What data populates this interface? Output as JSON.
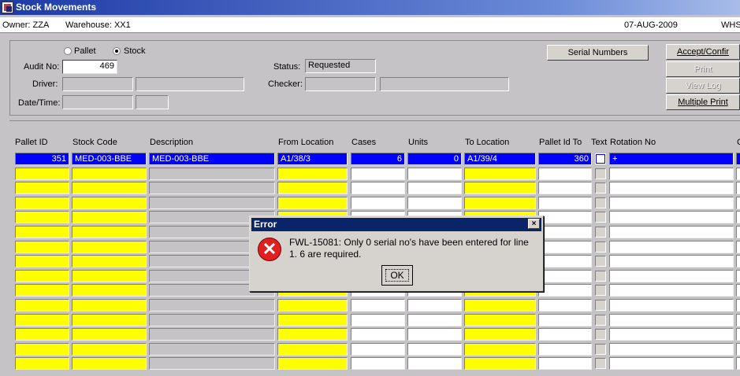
{
  "window": {
    "title": "Stock Movements"
  },
  "info": {
    "owner": "Owner:  ZZA",
    "warehouse": "Warehouse:  XX1",
    "date": "07-AUG-2009",
    "whs": "WHS"
  },
  "form": {
    "radio_pallet": "Pallet",
    "radio_stock": "Stock",
    "audit_label": "Audit No:",
    "audit_value": "469",
    "driver_label": "Driver:",
    "datetime_label": "Date/Time:",
    "status_label": "Status:",
    "status_value": "Requested",
    "checker_label": "Checker:"
  },
  "buttons": {
    "serial_numbers": "Serial Numbers",
    "accept_confirm": "Accept/Confir",
    "print": "Print",
    "view_log": "View Log",
    "multiple_print": "Multiple Print"
  },
  "columns": [
    "Pallet ID",
    "Stock Code",
    "Description",
    "From Location",
    "Cases",
    "Units",
    "To Location",
    "Pallet Id To",
    "Text",
    "Rotation No",
    "C"
  ],
  "first_row": {
    "pallet_id": "351",
    "stock_code": "MED-003-BBE",
    "description": "MED-003-BBE",
    "from_location": "A1/38/3",
    "cases": "6",
    "units": "0",
    "to_location": "A1/39/4",
    "pallet_id_to": "360",
    "rotation_no": "+"
  },
  "dialog": {
    "title": "Error",
    "close": "×",
    "message": "FWL-15081:  Only 0 serial no's have been entered for line 1.  6 are required.",
    "ok": "OK"
  }
}
